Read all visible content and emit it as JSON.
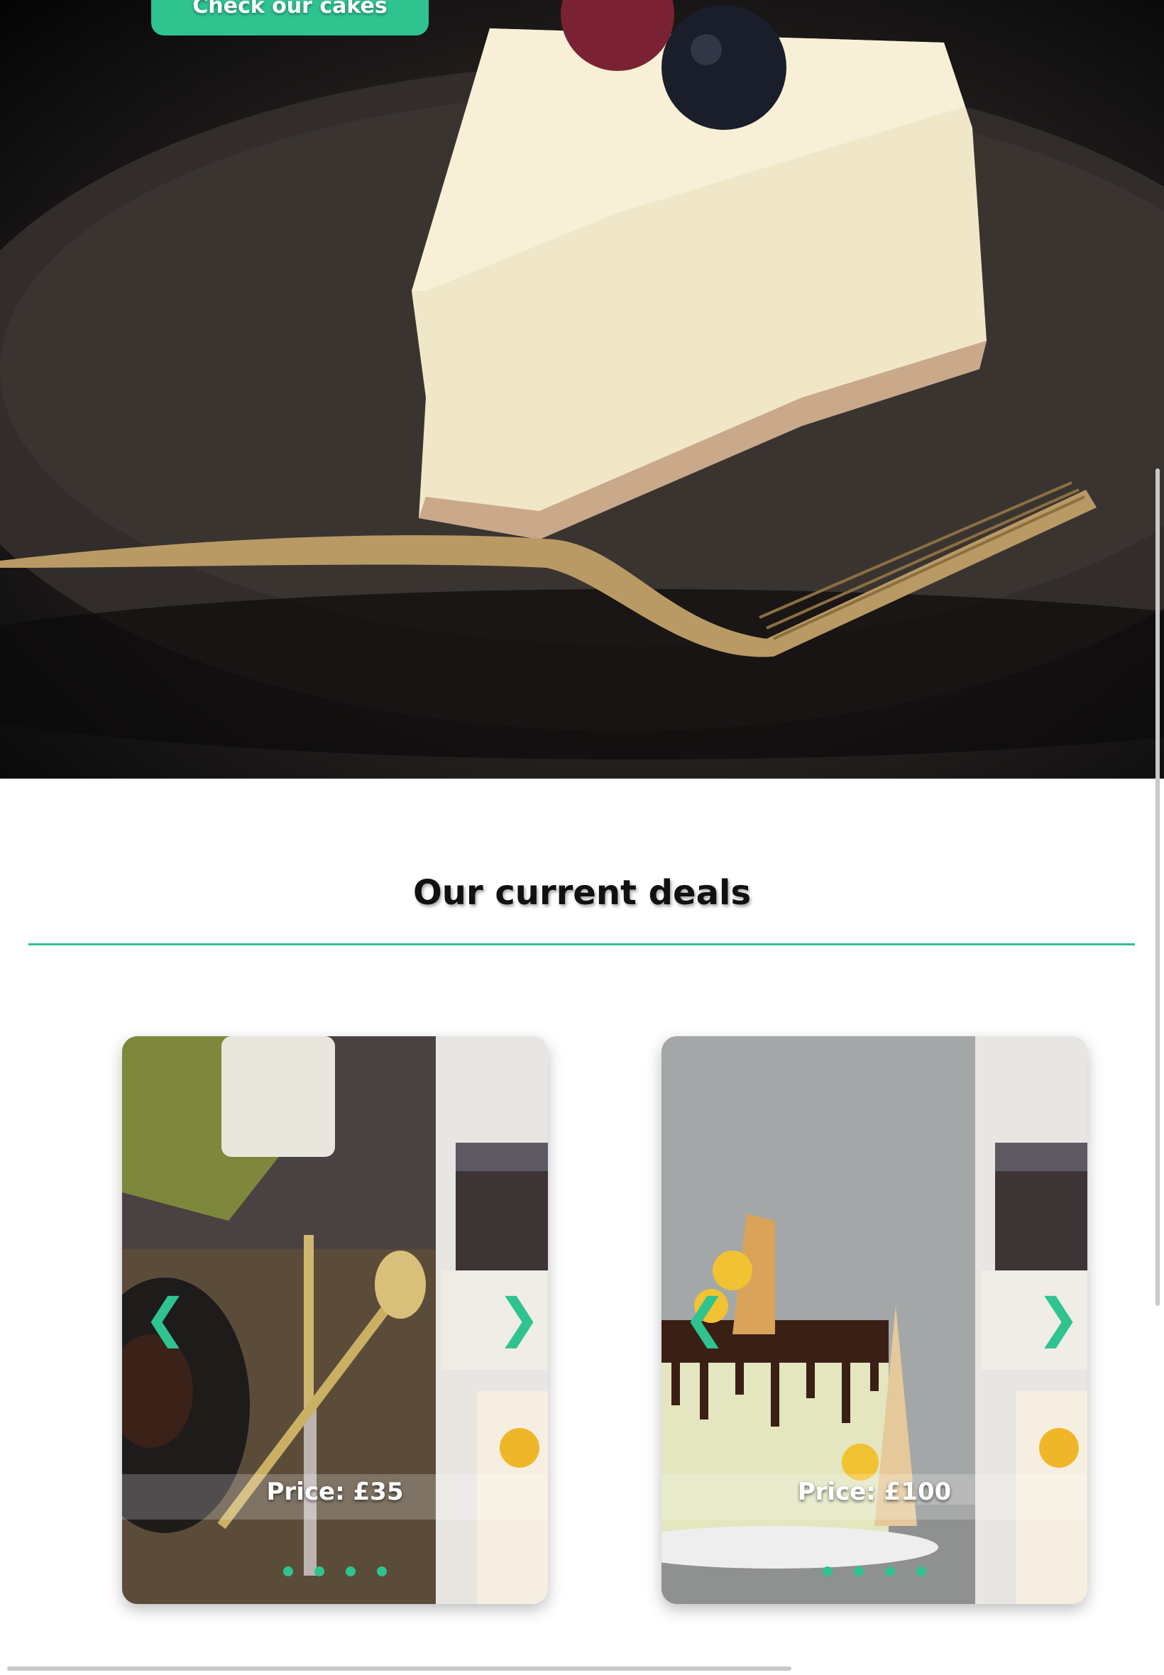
{
  "hero": {
    "cta_label": "Check our cakes"
  },
  "deals": {
    "title": "Our current deals",
    "cards": [
      {
        "price": "Price: £35",
        "prev_icon": "❮",
        "next_icon": "❯",
        "slides": 4
      },
      {
        "price": "Price: £100",
        "prev_icon": "❮",
        "next_icon": "❯",
        "slides": 4
      }
    ]
  },
  "colors": {
    "accent": "#2fc38f",
    "text": "#111111"
  }
}
